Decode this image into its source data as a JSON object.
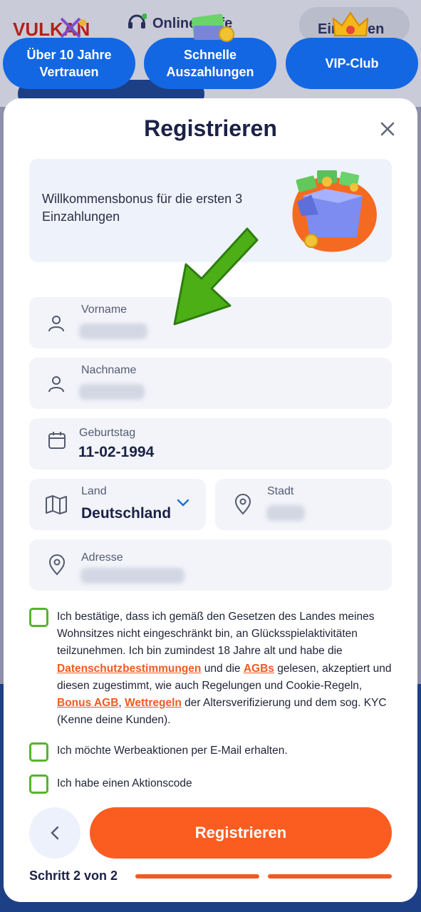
{
  "background": {
    "nav_online_help": "Online-Hilfe",
    "nav_deposit": "Einzahlen",
    "logo": "VULKAN"
  },
  "features": [
    "Über 10 Jahre\nVertrauen",
    "Schnelle\nAuszahlungen",
    "VIP-Club"
  ],
  "modal": {
    "title": "Registrieren",
    "bonus_text": "Willkommensbonus für die ersten 3 Einzahlungen",
    "fields": {
      "first_name": {
        "label": "Vorname"
      },
      "last_name": {
        "label": "Nachname"
      },
      "birthday": {
        "label": "Geburtstag",
        "value": "11-02-1994"
      },
      "country": {
        "label": "Land",
        "value": "Deutschland"
      },
      "city": {
        "label": "Stadt"
      },
      "address": {
        "label": "Adresse"
      }
    },
    "consent": {
      "part1": "Ich bestätige, dass ich gemäß den Gesetzen des Landes meines Wohnsitzes nicht eingeschränkt bin, an Glücksspielaktivitäten teilzunehmen. Ich bin zumindest 18 Jahre alt und habe die ",
      "link_privacy": "Datenschutzbestimmungen",
      "part2": " und die ",
      "link_terms": "AGBs",
      "part3": " gelesen, akzeptiert und diesen zugestimmt, wie auch Regelungen und Cookie-Regeln, ",
      "link_bonus": "Bonus AGB",
      "part4": ", ",
      "link_betting": "Wettregeln",
      "part5": " der Altersverifizierung und dem sog. KYC (Kenne deine Kunden)."
    },
    "newsletter": "Ich möchte Werbeaktionen per E-Mail erhalten.",
    "promo": "Ich habe einen Aktionscode",
    "submit_label": "Registrieren",
    "step_text": "Schritt 2 von 2",
    "step_current": 2,
    "step_total": 2
  },
  "colors": {
    "accent_orange": "#fb5d21",
    "feature_blue": "#1367e2",
    "checkbox_green": "#55b42c",
    "arrow_green": "#4caf16"
  }
}
